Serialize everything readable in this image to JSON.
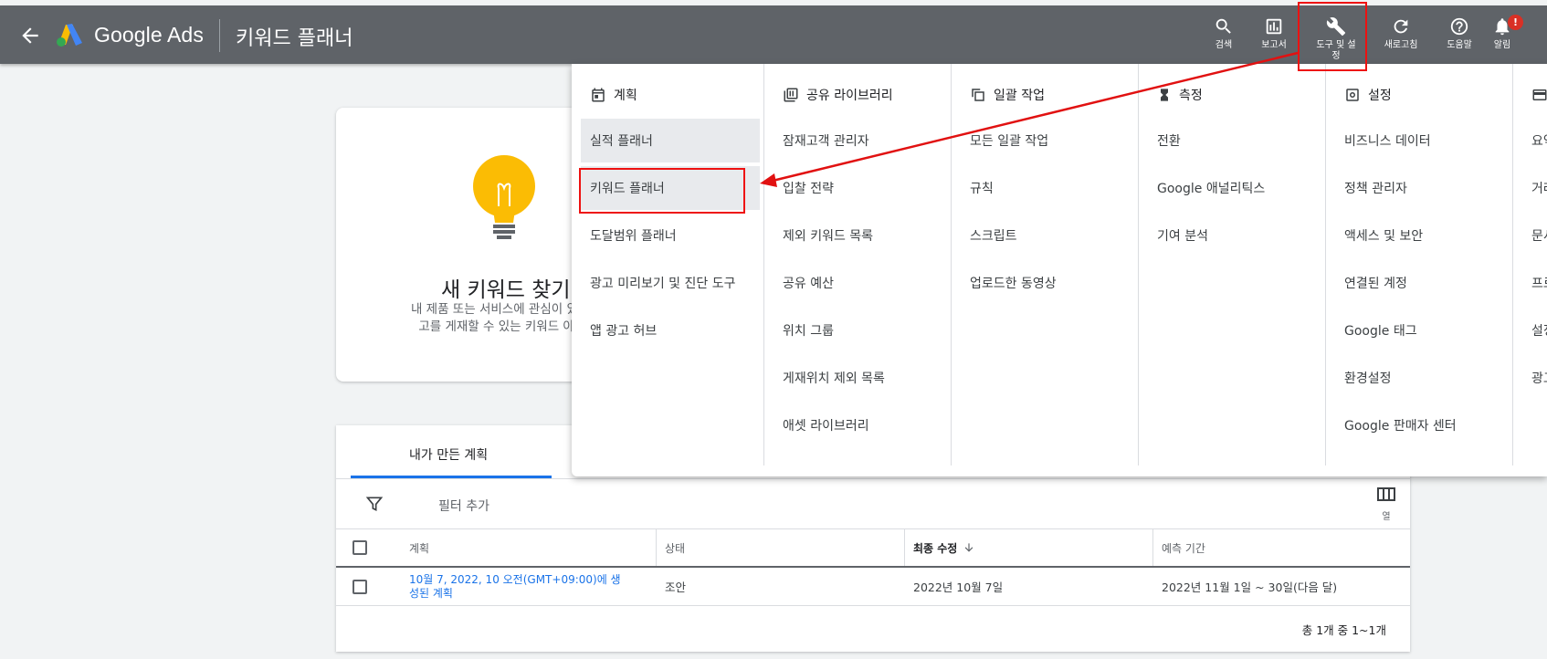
{
  "header": {
    "brand": "Google Ads",
    "page_title": "키워드 플래너",
    "buttons": [
      {
        "label": "검색",
        "icon": "search-icon"
      },
      {
        "label": "보고서",
        "icon": "bar-chart-icon"
      },
      {
        "label": "도구 및 설정",
        "icon": "wrench-icon"
      },
      {
        "label": "새로고침",
        "icon": "refresh-icon"
      },
      {
        "label": "도움말",
        "icon": "help-icon"
      },
      {
        "label": "알림",
        "icon": "bell-icon",
        "badge": "!"
      }
    ]
  },
  "card": {
    "title": "새 키워드 찾기",
    "description_line1": "내 제품 또는 서비스에 관심이 있는 사",
    "description_line2": "고를 게재할 수 있는 키워드 아이디"
  },
  "plans": {
    "tab_label": "내가 만든 계획",
    "filter_label": "필터 추가",
    "columns_button_label": "열",
    "columns": [
      "계획",
      "상태",
      "최종 수정",
      "예측 기간"
    ],
    "rows": [
      {
        "plan": "10월 7, 2022, 10 오전(GMT+09:00)에 생성된 계획",
        "status": "조안",
        "modified": "2022년 10월 7일",
        "forecast": "2022년 11월 1일 ~ 30일(다음 달)"
      }
    ],
    "pagination": "총 1개 중 1~1개"
  },
  "menu": {
    "columns": [
      {
        "header": "계획",
        "icon": "calendar-icon",
        "items": [
          "실적 플래너",
          "키워드 플래너",
          "도달범위 플래너",
          "광고 미리보기 및 진단 도구",
          "앱 광고 허브"
        ]
      },
      {
        "header": "공유 라이브러리",
        "icon": "library-icon",
        "items": [
          "잠재고객 관리자",
          "입찰 전략",
          "제외 키워드 목록",
          "공유 예산",
          "위치 그룹",
          "게재위치 제외 목록",
          "애셋 라이브러리"
        ]
      },
      {
        "header": "일괄 작업",
        "icon": "copy-icon",
        "items": [
          "모든 일괄 작업",
          "규칙",
          "스크립트",
          "업로드한 동영상"
        ]
      },
      {
        "header": "측정",
        "icon": "hourglass-icon",
        "items": [
          "전환",
          "Google 애널리틱스",
          "기여 분석"
        ]
      },
      {
        "header": "설정",
        "icon": "settings-box-icon",
        "items": [
          "비즈니스 데이터",
          "정책 관리자",
          "액세스 및 보안",
          "연결된 계정",
          "Google 태그",
          "환경설정",
          "Google 판매자 센터"
        ]
      },
      {
        "header": "",
        "icon": "card-icon",
        "items": [
          "요약",
          "거래",
          "문서",
          "프로",
          "설정",
          "광고"
        ]
      }
    ]
  },
  "colors": {
    "topbar": "#5f6368",
    "accent": "#1a73e8",
    "annotation": "#e11111",
    "bulb": "#fbbc04"
  }
}
